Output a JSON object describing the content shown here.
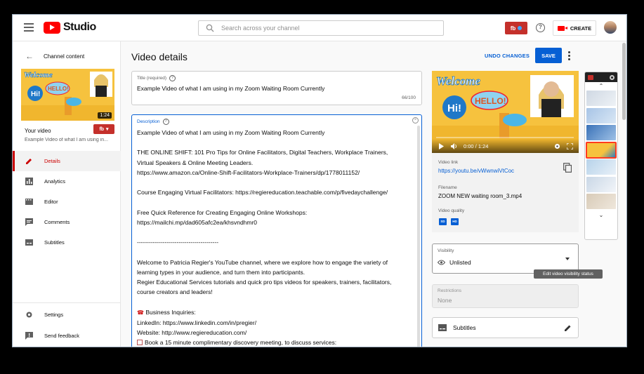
{
  "header": {
    "logo_text": "Studio",
    "search_placeholder": "Search across your channel",
    "account_badge": "fb",
    "create_label": "CREATE"
  },
  "sidebar": {
    "back_label": "Channel content",
    "thumbnail_duration": "1:24",
    "your_video_label": "Your video",
    "your_video_title": "Example Video of what I am using in...",
    "badge": "fb",
    "items": [
      {
        "label": "Details",
        "icon": "pencil-icon",
        "active": true
      },
      {
        "label": "Analytics",
        "icon": "analytics-icon"
      },
      {
        "label": "Editor",
        "icon": "editor-icon"
      },
      {
        "label": "Comments",
        "icon": "comments-icon"
      },
      {
        "label": "Subtitles",
        "icon": "subtitles-icon"
      }
    ],
    "bottom_items": [
      {
        "label": "Settings",
        "icon": "gear-icon"
      },
      {
        "label": "Send feedback",
        "icon": "feedback-icon"
      }
    ]
  },
  "main": {
    "page_title": "Video details",
    "undo_label": "UNDO CHANGES",
    "save_label": "SAVE",
    "title_field": {
      "label": "Title (required)",
      "value": "Example Video of what I am using in my Zoom Waiting Room Currently",
      "counter": "66/100"
    },
    "description_field": {
      "label": "Description",
      "lines": [
        "Example Video of what I am using in my Zoom Waiting Room Currently",
        "",
        "THE ONLINE SHIFT: 101 Pro Tips for Online Facilitators, Digital Teachers, Workplace Trainers,",
        "Virtual Speakers & Online Meeting Leaders.",
        "https://www.amazon.ca/Online-Shift-Facilitators-Workplace-Trainers/dp/1778011152/",
        "",
        "Course Engaging Virtual Facilitators: https://regiereducation.teachable.com/p/fivedaychallenge/",
        "",
        "Free Quick Reference for Creating Engaging Online Workshops:",
        "https://mailchi.mp/dad605afc2ea/khsvndhmr0",
        "",
        "-----------------------------------------",
        "",
        "Welcome to Patricia Regier's YouTube channel, where we explore how to engage the variety of",
        "learning types in your audience, and turn them into participants.",
        "Regier Educational Services tutorials and quick pro tips videos for speakers, trainers, facilitators,",
        "course creators and leaders!",
        "",
        "Business Inquiries:",
        "LinkedIn: https://www.linkedin.com/in/pregier/",
        "Website: http://www.regiereducation.com/",
        "Book a 15 minute complimentary discovery meeting, to discuss services:"
      ]
    }
  },
  "preview": {
    "time": "0:00 / 1:24",
    "video_link_label": "Video link",
    "video_link": "https://youtu.be/vWwnwiVtCoc",
    "filename_label": "Filename",
    "filename": "ZOOM NEW waiting room_3.mp4",
    "quality_label": "Video quality",
    "quality_badges": [
      "SD",
      "HD"
    ],
    "thumb_welcome": "Welcome",
    "thumb_hi": "Hi!",
    "thumb_hello": "HELLO!"
  },
  "visibility": {
    "label": "Visibility",
    "value": "Unlisted",
    "tooltip": "Edit video visibility status"
  },
  "restrictions": {
    "label": "Restrictions",
    "value": "None"
  },
  "subtitles_card": {
    "label": "Subtitles"
  },
  "colors": {
    "accent_blue": "#065fd4",
    "brand_red": "#ff0000",
    "active_red": "#cc0000",
    "thumbnail_yellow": "#f6c23e"
  }
}
